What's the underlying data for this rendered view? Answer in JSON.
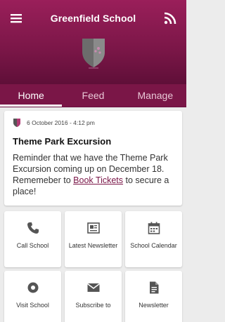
{
  "header": {
    "title": "Greenfield School",
    "menu_icon": "menu-icon",
    "rss_icon": "rss-icon",
    "brand_color": "#7a1647"
  },
  "tabs": [
    {
      "label": "Home",
      "active": true
    },
    {
      "label": "Feed",
      "active": false
    },
    {
      "label": "Manage",
      "active": false
    }
  ],
  "post": {
    "date": "6 October 2016 - 4:12 pm",
    "title": "Theme Park Excursion",
    "body_before": "Reminder that we have the Theme Park Excursion coming up on December 18. Rememeber to ",
    "link_text": "Book Tickets",
    "body_after": " to secure a place!"
  },
  "tiles": [
    {
      "label": "Call School",
      "icon": "phone-icon"
    },
    {
      "label": "Latest Newsletter",
      "icon": "newspaper-icon"
    },
    {
      "label": "School Calendar",
      "icon": "calendar-icon"
    },
    {
      "label": "Visit School",
      "icon": "location-icon"
    },
    {
      "label": "Subscribe to",
      "icon": "envelope-icon"
    },
    {
      "label": "Newsletter",
      "icon": "document-icon"
    }
  ]
}
